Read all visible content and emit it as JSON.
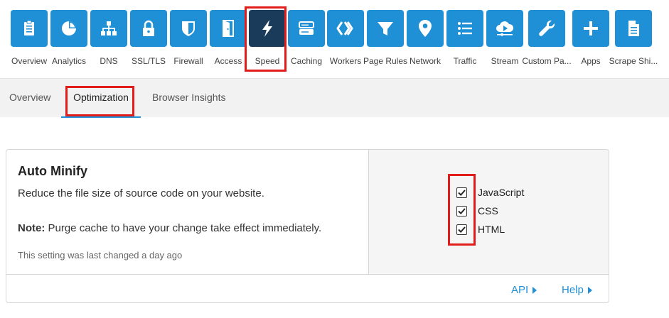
{
  "topnav": {
    "items": [
      {
        "label": "Overview",
        "icon": "clipboard-icon"
      },
      {
        "label": "Analytics",
        "icon": "pie-chart-icon"
      },
      {
        "label": "DNS",
        "icon": "network-tree-icon"
      },
      {
        "label": "SSL/TLS",
        "icon": "lock-icon"
      },
      {
        "label": "Firewall",
        "icon": "shield-icon"
      },
      {
        "label": "Access",
        "icon": "door-icon"
      },
      {
        "label": "Speed",
        "icon": "lightning-icon"
      },
      {
        "label": "Caching",
        "icon": "server-icon"
      },
      {
        "label": "Workers",
        "icon": "chevrons-icon"
      },
      {
        "label": "Page Rules",
        "icon": "filter-icon"
      },
      {
        "label": "Network",
        "icon": "location-pin-icon"
      },
      {
        "label": "Traffic",
        "icon": "list-icon"
      },
      {
        "label": "Stream",
        "icon": "cloud-play-icon"
      },
      {
        "label": "Custom Pa...",
        "icon": "wrench-icon"
      },
      {
        "label": "Apps",
        "icon": "plus-icon"
      },
      {
        "label": "Scrape Shi...",
        "icon": "document-icon"
      }
    ],
    "active": "Speed"
  },
  "subnav": {
    "tabs": [
      {
        "label": "Overview"
      },
      {
        "label": "Optimization"
      },
      {
        "label": "Browser Insights"
      }
    ],
    "active": "Optimization"
  },
  "auto_minify": {
    "title": "Auto Minify",
    "description": "Reduce the file size of source code on your website.",
    "note_label": "Note:",
    "note_text": " Purge cache to have your change take effect immediately.",
    "last_changed": "This setting was last changed a day ago",
    "options": [
      {
        "label": "JavaScript",
        "checked": true
      },
      {
        "label": "CSS",
        "checked": true
      },
      {
        "label": "HTML",
        "checked": true
      }
    ],
    "footer": {
      "api_label": "API",
      "help_label": "Help"
    }
  },
  "colors": {
    "accent": "#1f8fd6",
    "active_tile": "#1a3c5a",
    "highlight": "#e21b1b"
  }
}
